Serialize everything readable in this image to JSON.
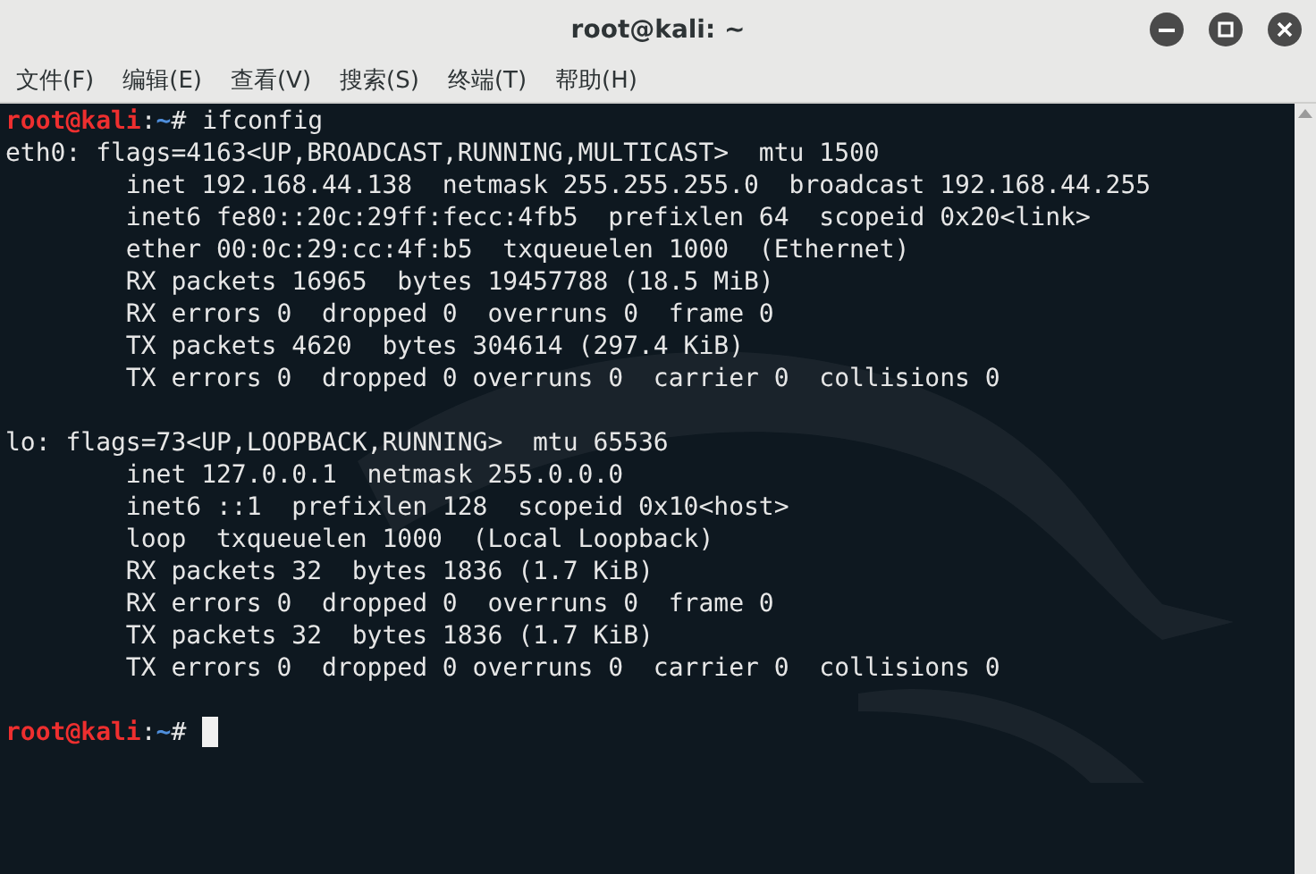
{
  "window": {
    "title": "root@kali: ~"
  },
  "menu": [
    "文件(F)",
    "编辑(E)",
    "查看(V)",
    "搜索(S)",
    "终端(T)",
    "帮助(H)"
  ],
  "terminal": {
    "lines": [
      {
        "kind": "prompt",
        "user_host": "root@kali",
        "separator": ":",
        "path": "~",
        "symbol": "#",
        "command": "ifconfig",
        "cursor": false
      },
      {
        "kind": "output",
        "text": "eth0: flags=4163<UP,BROADCAST,RUNNING,MULTICAST>  mtu 1500"
      },
      {
        "kind": "output",
        "text": "        inet 192.168.44.138  netmask 255.255.255.0  broadcast 192.168.44.255"
      },
      {
        "kind": "output",
        "text": "        inet6 fe80::20c:29ff:fecc:4fb5  prefixlen 64  scopeid 0x20<link>"
      },
      {
        "kind": "output",
        "text": "        ether 00:0c:29:cc:4f:b5  txqueuelen 1000  (Ethernet)"
      },
      {
        "kind": "output",
        "text": "        RX packets 16965  bytes 19457788 (18.5 MiB)"
      },
      {
        "kind": "output",
        "text": "        RX errors 0  dropped 0  overruns 0  frame 0"
      },
      {
        "kind": "output",
        "text": "        TX packets 4620  bytes 304614 (297.4 KiB)"
      },
      {
        "kind": "output",
        "text": "        TX errors 0  dropped 0 overruns 0  carrier 0  collisions 0"
      },
      {
        "kind": "blank"
      },
      {
        "kind": "output",
        "text": "lo: flags=73<UP,LOOPBACK,RUNNING>  mtu 65536"
      },
      {
        "kind": "output",
        "text": "        inet 127.0.0.1  netmask 255.0.0.0"
      },
      {
        "kind": "output",
        "text": "        inet6 ::1  prefixlen 128  scopeid 0x10<host>"
      },
      {
        "kind": "output",
        "text": "        loop  txqueuelen 1000  (Local Loopback)"
      },
      {
        "kind": "output",
        "text": "        RX packets 32  bytes 1836 (1.7 KiB)"
      },
      {
        "kind": "output",
        "text": "        RX errors 0  dropped 0  overruns 0  frame 0"
      },
      {
        "kind": "output",
        "text": "        TX packets 32  bytes 1836 (1.7 KiB)"
      },
      {
        "kind": "output",
        "text": "        TX errors 0  dropped 0 overruns 0  carrier 0  collisions 0"
      },
      {
        "kind": "blank"
      },
      {
        "kind": "prompt",
        "user_host": "root@kali",
        "separator": ":",
        "path": "~",
        "symbol": "#",
        "cursor": true
      }
    ]
  }
}
